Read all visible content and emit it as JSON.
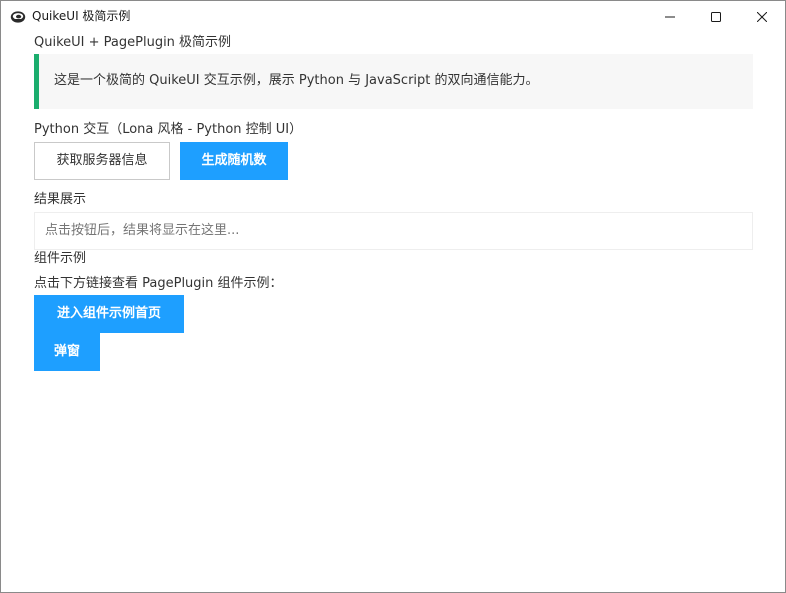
{
  "window": {
    "title": "QuikeUI 极简示例",
    "icon": "quikeui-app-icon",
    "controls": {
      "minimize_icon": "minimize-icon",
      "maximize_icon": "maximize-icon",
      "close_icon": "close-icon"
    }
  },
  "page": {
    "title": "QuikeUI + PagePlugin 极简示例",
    "intro": "这是一个极简的 QuikeUI 交互示例，展示 Python 与 JavaScript 的双向通信能力。",
    "accent_color": "#1aad6d",
    "primary_color": "#1e9fff"
  },
  "python_section": {
    "label": "Python 交互（Lona 风格 - Python 控制 UI）",
    "get_server_info_label": "获取服务器信息",
    "generate_random_label": "生成随机数"
  },
  "result_section": {
    "label": "结果展示",
    "placeholder": "点击按钮后，结果将显示在这里..."
  },
  "components_section": {
    "label": "组件示例",
    "hint": "点击下方链接查看 PagePlugin 组件示例：",
    "home_button_label": "进入组件示例首页",
    "popup_button_label": "弹窗"
  }
}
